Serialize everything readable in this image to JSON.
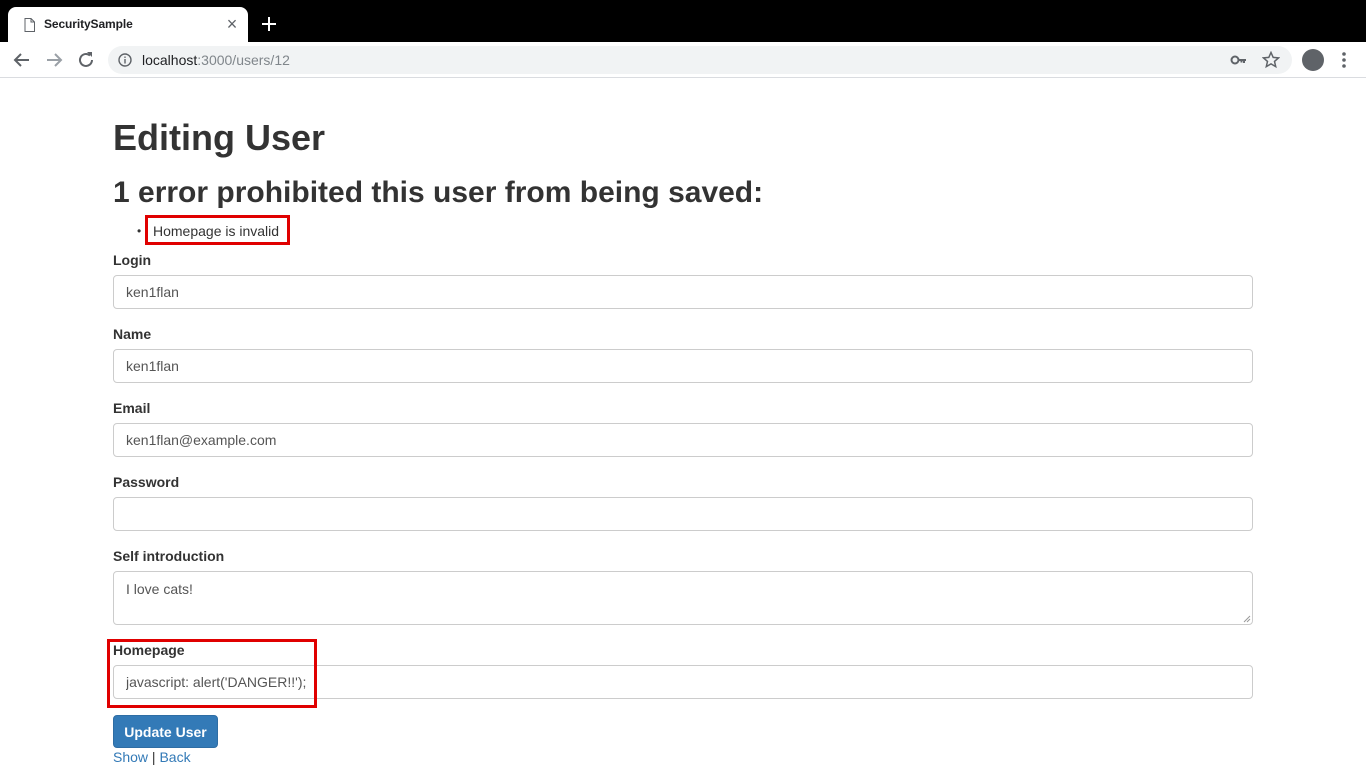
{
  "browser": {
    "tab_title": "SecuritySample",
    "url_host": "localhost",
    "url_path": ":3000/users/12"
  },
  "page": {
    "title": "Editing User",
    "error_heading": "1 error prohibited this user from being saved:",
    "errors": [
      "Homepage is invalid"
    ],
    "fields": {
      "login": {
        "label": "Login",
        "value": "ken1flan"
      },
      "name": {
        "label": "Name",
        "value": "ken1flan"
      },
      "email": {
        "label": "Email",
        "value": "ken1flan@example.com"
      },
      "password": {
        "label": "Password",
        "value": ""
      },
      "self_introduction": {
        "label": "Self introduction",
        "value": "I love cats!"
      },
      "homepage": {
        "label": "Homepage",
        "value": "javascript: alert('DANGER!!');"
      }
    },
    "submit_label": "Update User",
    "links": {
      "show": "Show",
      "separator": "|",
      "back": "Back"
    }
  },
  "colors": {
    "primary": "#337ab7",
    "highlight": "#e00000",
    "text": "#333333"
  }
}
